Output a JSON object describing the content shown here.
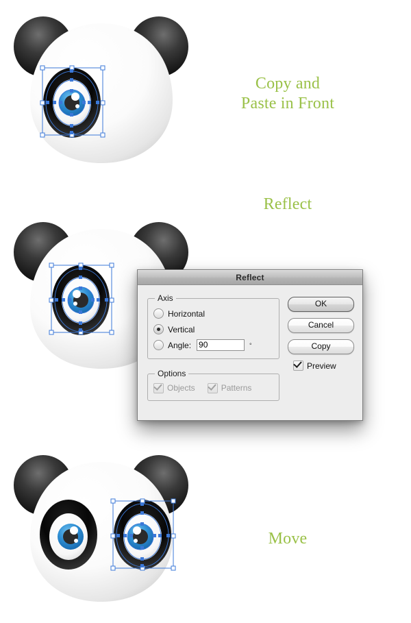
{
  "steps": [
    {
      "id": "copy",
      "label": "Copy and\nPaste in Front"
    },
    {
      "id": "reflect",
      "label": "Reflect"
    },
    {
      "id": "move",
      "label": "Move"
    }
  ],
  "label_color": "#9ac148",
  "dialog": {
    "title": "Reflect",
    "axis_group_label": "Axis",
    "axis_options": [
      {
        "label": "Horizontal",
        "selected": false
      },
      {
        "label": "Vertical",
        "selected": true
      },
      {
        "label": "Angle:",
        "selected": false
      }
    ],
    "angle_value": "90",
    "degree_symbol": "°",
    "options_group_label": "Options",
    "options": [
      {
        "label": "Objects",
        "checked": true,
        "enabled": false
      },
      {
        "label": "Patterns",
        "checked": true,
        "enabled": false
      }
    ],
    "buttons": [
      {
        "label": "OK",
        "default": true
      },
      {
        "label": "Cancel",
        "default": false
      },
      {
        "label": "Copy",
        "default": false
      }
    ],
    "preview": {
      "label": "Preview",
      "checked": true
    }
  },
  "artwork": {
    "description": "panda head illustration",
    "head_color": "#ffffff",
    "ear_color": "#1a1a1a",
    "iris_color": "#2f8fd4",
    "pupil_color": "#2b2b2b",
    "selection_color": "#3b78d8",
    "panels": [
      {
        "id": "panda-1",
        "eyes": [
          "right-selected"
        ]
      },
      {
        "id": "panda-2",
        "eyes": [
          "right-selected"
        ]
      },
      {
        "id": "panda-3",
        "eyes": [
          "left-plain",
          "right-selected"
        ]
      }
    ]
  }
}
